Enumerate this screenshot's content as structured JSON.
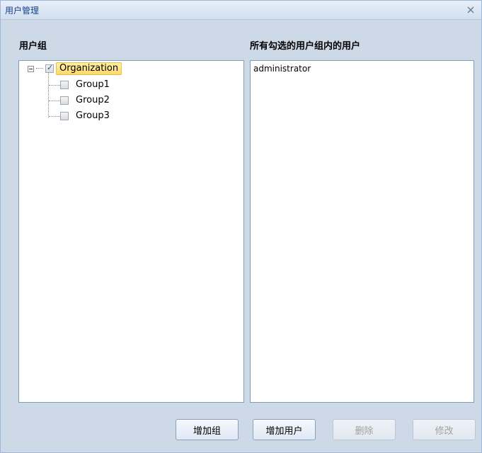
{
  "window": {
    "title": "用户管理"
  },
  "left_panel": {
    "label": "用户组",
    "tree": [
      {
        "label": "Organization",
        "checked": true,
        "selected": true,
        "expanded": true
      },
      {
        "label": "Group1",
        "checked": false
      },
      {
        "label": "Group2",
        "checked": false
      },
      {
        "label": "Group3",
        "checked": false
      }
    ]
  },
  "right_panel": {
    "label": "所有勾选的用户组内的用户",
    "users": [
      "administrator"
    ]
  },
  "buttons": {
    "add_group": "增加组",
    "add_user": "增加用户",
    "delete": "删除",
    "edit": "修改"
  }
}
